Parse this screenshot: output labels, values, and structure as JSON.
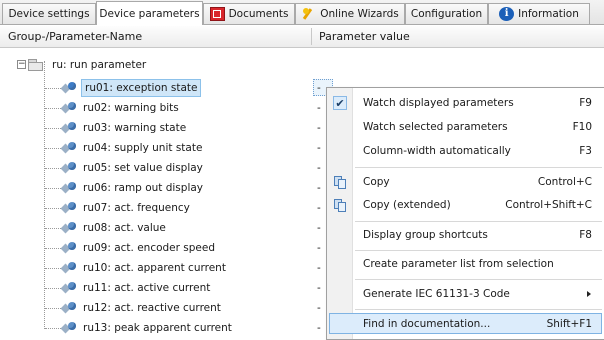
{
  "tabs": [
    {
      "label": "Device settings",
      "icon": null,
      "active": false
    },
    {
      "label": "Device parameters",
      "icon": null,
      "active": true
    },
    {
      "label": "Documents",
      "icon": "documents-icon",
      "active": false
    },
    {
      "label": "Online Wizards",
      "icon": "wizard-icon",
      "active": false
    },
    {
      "label": "Configuration",
      "icon": null,
      "active": false
    },
    {
      "label": "Information",
      "icon": "info-icon",
      "active": false
    }
  ],
  "columns": {
    "name": "Group-/Parameter-Name",
    "value": "Parameter value"
  },
  "group": {
    "label": "ru: run parameter",
    "expander": "−"
  },
  "parameters": [
    {
      "label": "ru01: exception state",
      "value": "-"
    },
    {
      "label": "ru02: warning bits",
      "value": "-"
    },
    {
      "label": "ru03: warning state",
      "value": "-"
    },
    {
      "label": "ru04: supply unit state",
      "value": "-"
    },
    {
      "label": "ru05: set value display",
      "value": "-"
    },
    {
      "label": "ru06: ramp out display",
      "value": "-"
    },
    {
      "label": "ru07: act. frequency",
      "value": "-"
    },
    {
      "label": "ru08: act. value",
      "value": "-"
    },
    {
      "label": "ru09: act. encoder speed",
      "value": "-"
    },
    {
      "label": "ru10: act. apparent current",
      "value": "-"
    },
    {
      "label": "ru11: act. active current",
      "value": "-"
    },
    {
      "label": "ru12: act. reactive current",
      "value": "-"
    },
    {
      "label": "ru13: peak apparent current",
      "value": "-"
    }
  ],
  "context_menu": [
    {
      "label": "Watch displayed parameters",
      "shortcut": "F9",
      "icon": "checkmark"
    },
    {
      "label": "Watch selected parameters",
      "shortcut": "F10"
    },
    {
      "label": "Column-width automatically",
      "shortcut": "F3"
    },
    {
      "separator": true
    },
    {
      "label": "Copy",
      "shortcut": "Control+C",
      "icon": "copy-icon"
    },
    {
      "label": "Copy (extended)",
      "shortcut": "Control+Shift+C",
      "icon": "copy-icon"
    },
    {
      "separator": true
    },
    {
      "label": "Display group shortcuts",
      "shortcut": "F8"
    },
    {
      "separator": true
    },
    {
      "label": "Create parameter list from selection"
    },
    {
      "separator": true
    },
    {
      "label": "Generate IEC 61131-3 Code",
      "submenu": true
    },
    {
      "separator": true
    },
    {
      "label": "Find in documentation...",
      "shortcut": "Shift+F1",
      "highlighted": true
    }
  ],
  "check_glyph": "✔"
}
